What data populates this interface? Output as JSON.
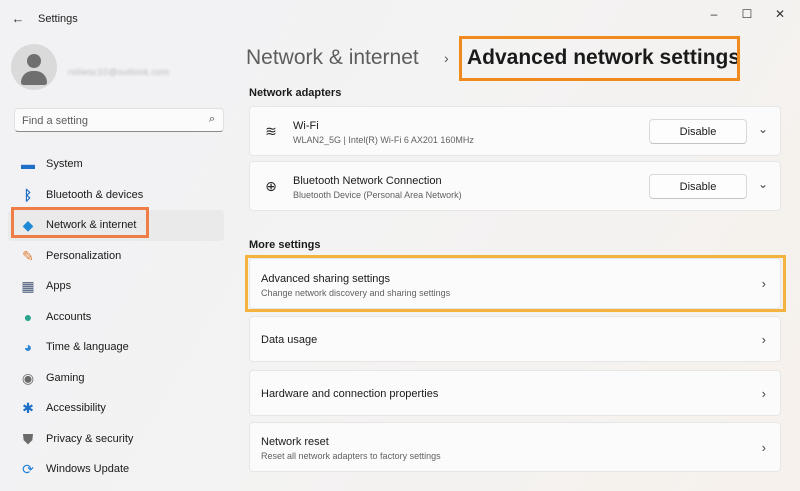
{
  "window": {
    "title": "Settings",
    "back_glyph": "←",
    "minimize_glyph": "–",
    "maximize_glyph": "☐",
    "close_glyph": "✕"
  },
  "account": {
    "name": "rstlwsc10@outlook.com"
  },
  "search": {
    "placeholder": "Find a setting",
    "icon": "search-icon"
  },
  "sidebar": {
    "items": [
      {
        "label": "System",
        "icon": "display-icon",
        "glyph": "▬",
        "color": "#1e6fc8"
      },
      {
        "label": "Bluetooth & devices",
        "icon": "bluetooth-icon",
        "glyph": "ᛒ",
        "color": "#1e6fc8"
      },
      {
        "label": "Network & internet",
        "icon": "wifi-icon",
        "glyph": "◆",
        "color": "#1e8ad6",
        "active": true
      },
      {
        "label": "Personalization",
        "icon": "brush-icon",
        "glyph": "✎",
        "color": "#e07b2c"
      },
      {
        "label": "Apps",
        "icon": "apps-icon",
        "glyph": "▦",
        "color": "#4a5a7a"
      },
      {
        "label": "Accounts",
        "icon": "person-icon",
        "glyph": "●",
        "color": "#2aa38c"
      },
      {
        "label": "Time & language",
        "icon": "globe-clock-icon",
        "glyph": "◕",
        "color": "#2a86d6"
      },
      {
        "label": "Gaming",
        "icon": "gamepad-icon",
        "glyph": "◉",
        "color": "#6a6a6a"
      },
      {
        "label": "Accessibility",
        "icon": "accessibility-icon",
        "glyph": "✱",
        "color": "#1e6fc8"
      },
      {
        "label": "Privacy & security",
        "icon": "shield-icon",
        "glyph": "⛊",
        "color": "#6b6b6b"
      },
      {
        "label": "Windows Update",
        "icon": "update-icon",
        "glyph": "⟳",
        "color": "#1e7fd6"
      }
    ]
  },
  "breadcrumb": {
    "parent": "Network & internet",
    "separator": "›",
    "current": "Advanced network settings"
  },
  "adapters": {
    "heading": "Network adapters",
    "items": [
      {
        "name": "Wi-Fi",
        "detail": "WLAN2_5G | Intel(R) Wi-Fi 6 AX201 160MHz",
        "icon": "wifi-icon",
        "glyph": "≋",
        "button": "Disable",
        "chevron": "⌄"
      },
      {
        "name": "Bluetooth Network Connection",
        "detail": "Bluetooth Device (Personal Area Network)",
        "icon": "globe-icon",
        "glyph": "⊕",
        "button": "Disable",
        "chevron": "⌄"
      }
    ]
  },
  "more": {
    "heading": "More settings",
    "items": [
      {
        "title": "Advanced sharing settings",
        "subtitle": "Change network discovery and sharing settings",
        "arrow": "›"
      },
      {
        "title": "Data usage",
        "subtitle": "",
        "arrow": "›"
      },
      {
        "title": "Hardware and connection properties",
        "subtitle": "",
        "arrow": "›"
      },
      {
        "title": "Network reset",
        "subtitle": "Reset all network adapters to factory settings",
        "arrow": "›"
      }
    ]
  },
  "colors": {
    "nav_highlight": "#ef7d46",
    "title_highlight": "#f08a1d",
    "sharing_highlight": "#f3b33e"
  }
}
